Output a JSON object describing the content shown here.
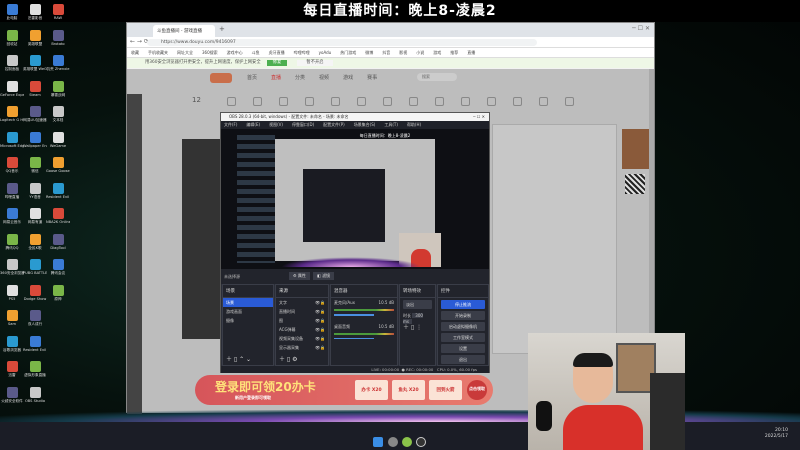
{
  "overlay_title": "每日直播时间：晚上8-凌晨2",
  "desktop_icons": [
    "此电脑",
    "迅雷影音",
    "RAW",
    "回收站",
    "英雄联盟",
    "Brotato",
    "控制面板",
    "英雄联盟 WeGame版",
    "饥荒 Zhenxie",
    "GeForce Experience",
    "Steam",
    "暴雪战网",
    "Logitech G HUB",
    "网易UU加速器",
    "文本档",
    "Microsoft Edge",
    "Wallpaper Engine",
    "WeGame",
    "QQ音乐",
    "微信",
    "Goose Goose Duck",
    "哔哩直播",
    "YY语音",
    "Resident Evil Village",
    "网易云音乐",
    "网易有道",
    "NBA2K Online",
    "腾讯QQ",
    "全民K歌",
    "DiagTool",
    "360安全浏览器",
    "PUBG BATTLEGROUNDS",
    "腾讯会议",
    "PS5",
    "Dodge Show",
    "原神",
    "Sam",
    "双人成行",
    "",
    "谷歌浏览器",
    "Resident Evil 7",
    "",
    "迅雷",
    "虚拟形象直播",
    "",
    "火绒安全软件",
    "OBS Studio",
    ""
  ],
  "browser": {
    "tab_title": "斗鱼直播间 - 游戏直播",
    "url": "https://www.douyu.com/9416097",
    "bookmarks": [
      "收藏",
      "手机收藏夹",
      "网址大全",
      "360搜索",
      "游戏中心",
      "斗鱼",
      "虎牙直播",
      "哔哩哔哩",
      "yoAdu",
      "热门游戏",
      "微博",
      "抖音",
      "影视",
      "小说",
      "游戏",
      "推荐",
      "直播"
    ],
    "notice": "用360安全浏览器打开更安全，提升上网速度，保护上网安全",
    "notice_button": "修复",
    "notice_link": "暂不开启",
    "nav": [
      "首页",
      "直播",
      "分类",
      "视频",
      "游戏",
      "赛事"
    ],
    "search_placeholder": "搜索",
    "level": "12"
  },
  "obs": {
    "title": "OBS 28.0.3 (64-bit, windows) - 配置文件: 未命名 - 场景: 未命名",
    "menu": [
      "文件(F)",
      "编辑(E)",
      "视图(V)",
      "停靠窗口(D)",
      "配置文件(P)",
      "场景集合(S)",
      "工具(T)",
      "帮助(H)"
    ],
    "no_source": "未选择源",
    "props": "属性",
    "filters": "滤镜",
    "scenes_title": "场景",
    "scenes": [
      "场景",
      "游戏画面",
      "摄像"
    ],
    "sources_title": "来源",
    "sources": [
      "文字",
      "直播时间",
      "图",
      "ACG弹幕",
      "视频采集设备",
      "显示器采集"
    ],
    "mixer_title": "混音器",
    "mixer": [
      {
        "name": "麦克风/Aux",
        "db": "10.5 dB"
      },
      {
        "name": "桌面音频",
        "db": "10.5 dB"
      }
    ],
    "transitions_title": "转场特效",
    "transition": "淡出",
    "duration_label": "时长",
    "duration": "300 ms",
    "controls_title": "控件",
    "controls": [
      "停止推流",
      "开始录制",
      "启动虚拟摄像机",
      "工作室模式",
      "设置",
      "退出"
    ],
    "status_live": "LIVE: 00:00:00",
    "status_rec": "REC: 00:00:00",
    "status_cpu": "CPU: 0.0%, 60.00 fps"
  },
  "banner": {
    "text": "登录即可领20办卡",
    "sub": "新用户登录即可领取",
    "items": [
      "办卡 X20",
      "鱼丸 X20",
      "回到火箭"
    ],
    "cta": "点击领取"
  },
  "taskbar": {
    "time": "20:10",
    "date": "2022/5/17"
  }
}
